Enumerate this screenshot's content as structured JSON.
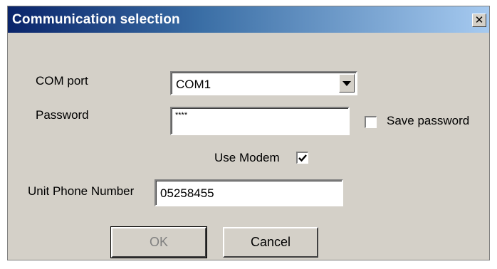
{
  "window": {
    "title": "Communication selection",
    "close_glyph": "✕"
  },
  "form": {
    "com_port": {
      "label": "COM port",
      "value": "COM1"
    },
    "password": {
      "label": "Password",
      "value": "****"
    },
    "save_password": {
      "label": "Save password",
      "checked": false
    },
    "use_modem": {
      "label": "Use Modem",
      "checked": true
    },
    "phone": {
      "label": "Unit Phone Number",
      "value": "05258455"
    }
  },
  "buttons": {
    "ok_label": "OK",
    "cancel_label": "Cancel"
  },
  "colors": {
    "titlebar_start": "#0a246a",
    "titlebar_end": "#a6caf0",
    "dialog_bg": "#d4d0c8"
  },
  "icons": {
    "close": "close-icon",
    "dropdown": "chevron-down-icon",
    "check": "checkmark-icon"
  }
}
